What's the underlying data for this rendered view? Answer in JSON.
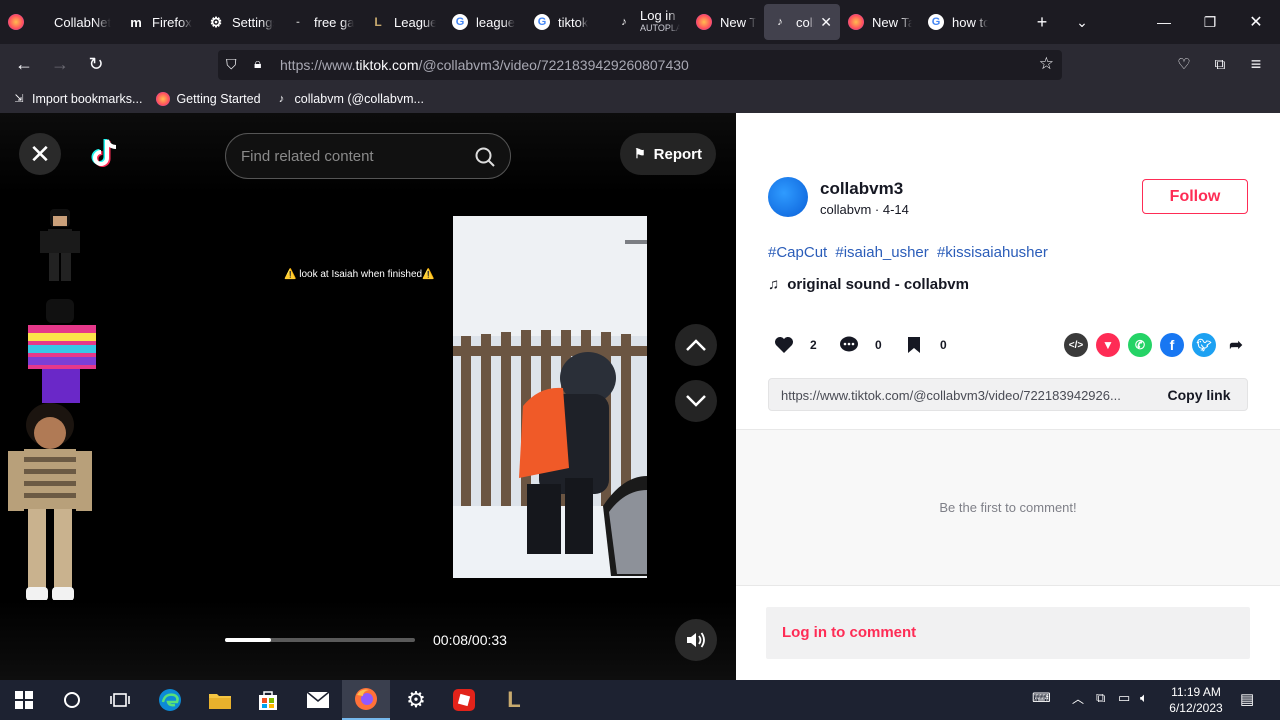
{
  "browser": {
    "tabs": [
      {
        "label": "",
        "icon": "firefox-icon"
      },
      {
        "label": "CollabNet",
        "icon": ""
      },
      {
        "label": "Firefox",
        "icon": "medium-icon"
      },
      {
        "label": "Settings",
        "icon": "gear-icon"
      },
      {
        "label": "free ga",
        "icon": "dash-icon"
      },
      {
        "label": "League",
        "icon": "league-icon"
      },
      {
        "label": "league",
        "icon": "google-icon"
      },
      {
        "label": "tiktok",
        "icon": "google-icon"
      },
      {
        "label": "Log in",
        "sub": "AUTOPLA",
        "icon": "tiktok-icon"
      },
      {
        "label": "New Ta",
        "icon": "firefox-icon"
      },
      {
        "label": "colla",
        "icon": "tiktok-icon",
        "active": true
      },
      {
        "label": "New Ta",
        "icon": "firefox-icon"
      },
      {
        "label": "how to",
        "icon": "google-icon"
      }
    ],
    "url_prefix": "https://www.",
    "url_domain": "tiktok.com",
    "url_path": "/@collabvm3/video/7221839429260807430",
    "bookmarks": [
      {
        "label": "Import bookmarks...",
        "icon": "import-icon"
      },
      {
        "label": "Getting Started",
        "icon": "firefox-icon"
      },
      {
        "label": "collabvm (@collabvm...",
        "icon": "tiktok-icon"
      }
    ]
  },
  "video": {
    "search_placeholder": "Find related content",
    "report_label": "Report",
    "overlay_text": "⚠️ look at Isaiah when finished⚠️",
    "time": "00:08/00:33",
    "progress": 0.24
  },
  "post": {
    "username": "collabvm3",
    "subline": "collabvm · 4-14",
    "follow_label": "Follow",
    "hashtags": [
      "#CapCut",
      "#isaiah_usher",
      "#kissisaiahusher"
    ],
    "sound": "original sound - collabvm",
    "likes": "2",
    "comments": "0",
    "saves": "0",
    "link": "https://www.tiktok.com/@collabvm3/video/722183942926...",
    "copy_label": "Copy link",
    "empty_comments": "Be the first to comment!",
    "login_prompt": "Log in to comment"
  },
  "taskbar": {
    "time": "11:19 AM",
    "date": "6/12/2023"
  }
}
